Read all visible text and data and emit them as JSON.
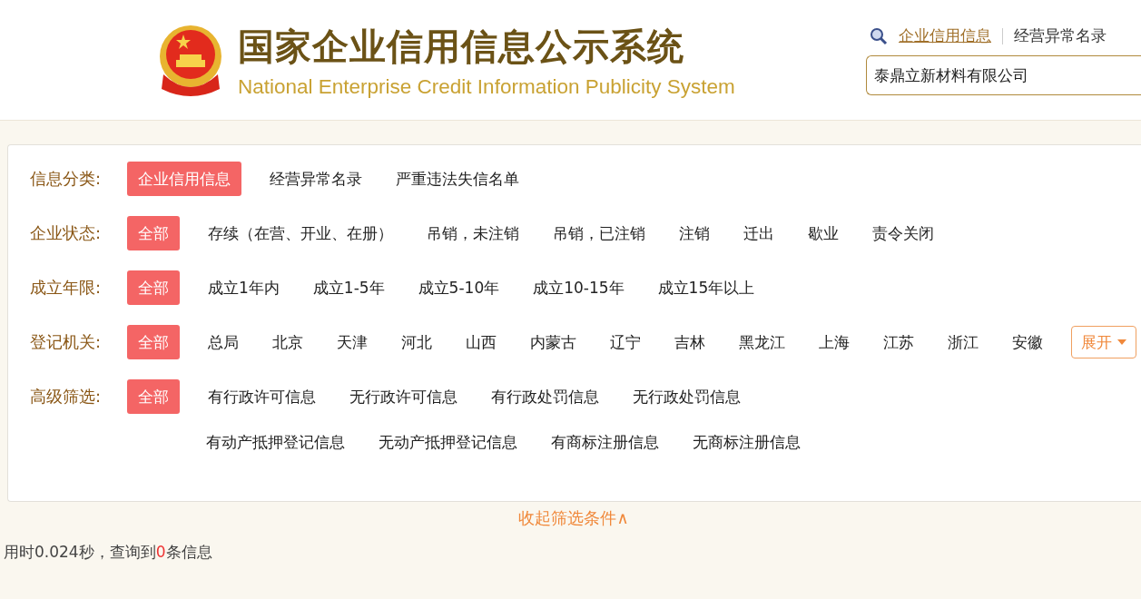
{
  "header": {
    "title": "国家企业信用信息公示系统",
    "subtitle": "National Enterprise Credit Information Publicity System",
    "nav": [
      {
        "label": "企业信用信息",
        "selected": true
      },
      {
        "label": "经营异常名录",
        "selected": false
      }
    ],
    "search": {
      "value": "泰鼎立新材料有限公司"
    }
  },
  "filters": [
    {
      "label": "信息分类:",
      "lines": [
        [
          {
            "label": "企业信用信息",
            "selected": true
          },
          {
            "label": "经营异常名录",
            "selected": false
          },
          {
            "label": "严重违法失信名单",
            "selected": false
          }
        ]
      ]
    },
    {
      "label": "企业状态:",
      "lines": [
        [
          {
            "label": "全部",
            "selected": true
          },
          {
            "label": "存续（在营、开业、在册）",
            "selected": false
          },
          {
            "label": "吊销，未注销",
            "selected": false
          },
          {
            "label": "吊销，已注销",
            "selected": false
          },
          {
            "label": "注销",
            "selected": false
          },
          {
            "label": "迁出",
            "selected": false
          },
          {
            "label": "歇业",
            "selected": false
          },
          {
            "label": "责令关闭",
            "selected": false
          }
        ]
      ]
    },
    {
      "label": "成立年限:",
      "lines": [
        [
          {
            "label": "全部",
            "selected": true
          },
          {
            "label": "成立1年内",
            "selected": false
          },
          {
            "label": "成立1-5年",
            "selected": false
          },
          {
            "label": "成立5-10年",
            "selected": false
          },
          {
            "label": "成立10-15年",
            "selected": false
          },
          {
            "label": "成立15年以上",
            "selected": false
          }
        ]
      ]
    },
    {
      "label": "登记机关:",
      "expand": "展开",
      "lines": [
        [
          {
            "label": "全部",
            "selected": true
          },
          {
            "label": "总局",
            "selected": false
          },
          {
            "label": "北京",
            "selected": false
          },
          {
            "label": "天津",
            "selected": false
          },
          {
            "label": "河北",
            "selected": false
          },
          {
            "label": "山西",
            "selected": false
          },
          {
            "label": "内蒙古",
            "selected": false
          },
          {
            "label": "辽宁",
            "selected": false
          },
          {
            "label": "吉林",
            "selected": false
          },
          {
            "label": "黑龙江",
            "selected": false
          },
          {
            "label": "上海",
            "selected": false
          },
          {
            "label": "江苏",
            "selected": false
          },
          {
            "label": "浙江",
            "selected": false
          },
          {
            "label": "安徽",
            "selected": false
          }
        ]
      ]
    },
    {
      "label": "高级筛选:",
      "lines": [
        [
          {
            "label": "全部",
            "selected": true
          },
          {
            "label": "有行政许可信息",
            "selected": false
          },
          {
            "label": "无行政许可信息",
            "selected": false
          },
          {
            "label": "有行政处罚信息",
            "selected": false
          },
          {
            "label": "无行政处罚信息",
            "selected": false
          }
        ],
        [
          {
            "label": "有动产抵押登记信息",
            "selected": false
          },
          {
            "label": "无动产抵押登记信息",
            "selected": false
          },
          {
            "label": "有商标注册信息",
            "selected": false
          },
          {
            "label": "无商标注册信息",
            "selected": false
          }
        ]
      ]
    }
  ],
  "collapse": "收起筛选条件∧",
  "result": {
    "prefix": "用时0.024秒，查询到",
    "count": "0",
    "suffix": "条信息"
  }
}
